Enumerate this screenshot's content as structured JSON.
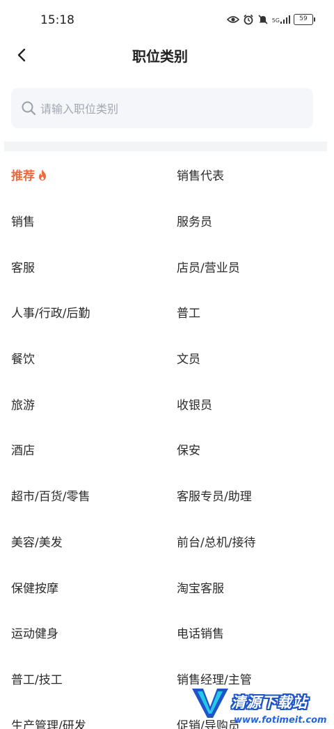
{
  "status_bar": {
    "time": "15:18",
    "network": "5G",
    "battery": "59",
    "icons": [
      "eye-icon",
      "alarm-icon",
      "mute-icon",
      "signal-icon",
      "battery-icon"
    ]
  },
  "nav": {
    "title": "职位类别",
    "back_icon": "chevron-left-icon"
  },
  "search": {
    "placeholder": "请输入职位类别",
    "icon": "search-icon"
  },
  "colors": {
    "accent": "#ee6a3d",
    "search_bg": "#f4f6f9",
    "placeholder": "#a3a8b1",
    "divider": "#f3f4f6"
  },
  "categories": {
    "rows": [
      [
        "推荐",
        "销售代表"
      ],
      [
        "销售",
        "服务员"
      ],
      [
        "客服",
        "店员/营业员"
      ],
      [
        "人事/行政/后勤",
        "普工"
      ],
      [
        "餐饮",
        "文员"
      ],
      [
        "旅游",
        "收银员"
      ],
      [
        "酒店",
        "保安"
      ],
      [
        "超市/百货/零售",
        "客服专员/助理"
      ],
      [
        "美容/美发",
        "前台/总机/接待"
      ],
      [
        "保健按摩",
        "淘宝客服"
      ],
      [
        "运动健身",
        "电话销售"
      ],
      [
        "普工/技工",
        "销售经理/主管"
      ],
      [
        "生产管理/研发",
        "促销/导购员"
      ]
    ],
    "active_icon": "fire-icon"
  },
  "watermark": {
    "title": "清源下载站",
    "url": "www.fotimeit.com"
  }
}
